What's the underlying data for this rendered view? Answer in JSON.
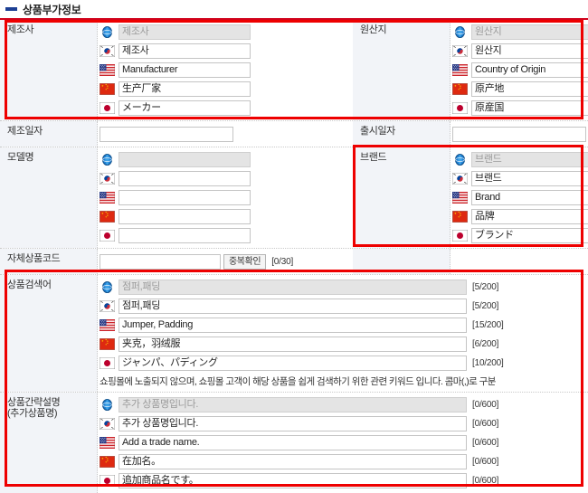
{
  "header": {
    "title": "상품부가정보",
    "marker": "navy-dash"
  },
  "colors": {
    "accent": "#d0021b",
    "highlight": "#ee0000",
    "marker": "#1c3f94",
    "label_bg": "#f2f4f8",
    "disabled_bg": "#e4e4e4"
  },
  "languages": [
    {
      "code": "default",
      "icon": "globe-icon"
    },
    {
      "code": "ko",
      "icon": "flag-kr-icon"
    },
    {
      "code": "en",
      "icon": "flag-us-icon"
    },
    {
      "code": "zh",
      "icon": "flag-cn-icon"
    },
    {
      "code": "ja",
      "icon": "flag-jp-icon"
    }
  ],
  "sections": {
    "manufacturer": {
      "label": "제조사",
      "values": [
        "제조사",
        "제조사",
        "Manufacturer",
        "生产厂家",
        "メーカー"
      ],
      "highlighted": true
    },
    "origin": {
      "label": "원산지",
      "values": [
        "원산지",
        "원산지",
        "Country of Origin",
        "原产地",
        "原産国"
      ],
      "highlighted": true
    },
    "manufacture_date": {
      "label": "제조일자",
      "value": "",
      "icon": "calendar-icon"
    },
    "release_date": {
      "label": "출시일자",
      "value": "",
      "icon": "calendar-icon"
    },
    "model_name": {
      "label": "모델명",
      "values": [
        "",
        "",
        "",
        "",
        ""
      ],
      "highlighted": false
    },
    "brand": {
      "label": "브랜드",
      "values": [
        "브랜드",
        "브랜드",
        "Brand",
        "品牌",
        "ブランド"
      ],
      "highlighted": true
    },
    "own_product_code": {
      "label": "자체상품코드",
      "value": "",
      "button_label": "중복확인",
      "counter": "[0/30]"
    },
    "search_keywords": {
      "label": "상품검색어",
      "values": [
        "점퍼,패딩",
        "점퍼,패딩",
        "Jumper, Padding",
        "夹克，羽绒服",
        "ジャンパ、パディング"
      ],
      "counters": [
        "[5/200]",
        "[5/200]",
        "[15/200]",
        "[6/200]",
        "[10/200]"
      ],
      "help": "쇼핑몰에 노출되지 않으며, 쇼핑몰 고객이 해당 상품을 쉽게 검색하기 위한 관련 키워드 입니다. 콤마(,)로 구분",
      "highlighted": true
    },
    "short_description": {
      "label_line1": "상품간략설명",
      "label_line2": "(추가상품명)",
      "values": [
        "추가 상품명입니다.",
        "추가 상품명입니다.",
        "Add a trade name.",
        "在加名。",
        "追加商品名です。"
      ],
      "counters": [
        "[0/600]",
        "[0/600]",
        "[0/600]",
        "[0/600]",
        "[0/600]"
      ],
      "highlighted": true
    }
  }
}
